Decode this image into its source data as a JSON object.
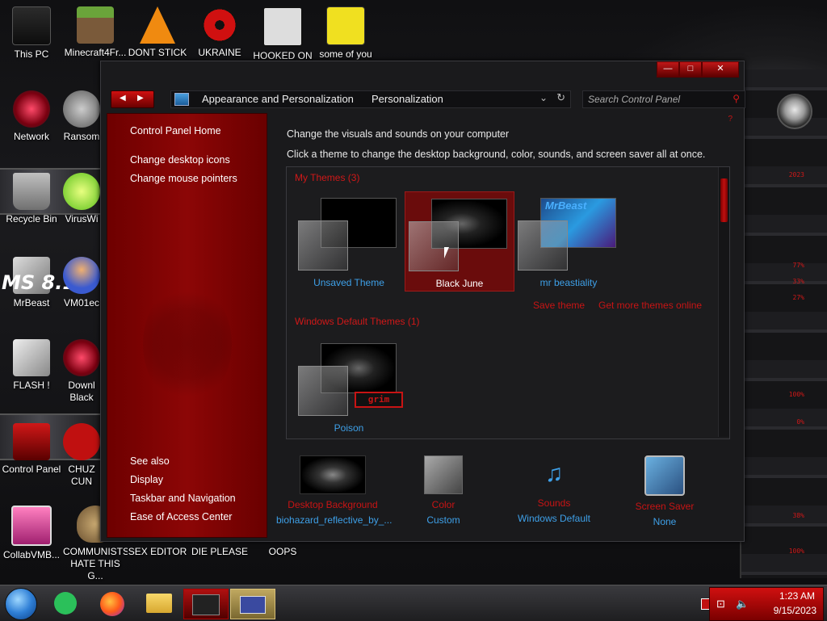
{
  "desktop": {
    "icons": [
      {
        "label": "This PC",
        "name": "this-pc-icon"
      },
      {
        "label": "Minecraft4Fr...",
        "name": "minecraft-icon"
      },
      {
        "label": "DONT STICK",
        "name": "vlc-cone-icon"
      },
      {
        "label": "UKRAINE",
        "name": "radiation-icon"
      },
      {
        "label": "HOOKED ON",
        "name": "maze-icon"
      },
      {
        "label": "some of you",
        "name": "cartoon-dog-icon"
      },
      {
        "label": "Network",
        "name": "network-icon"
      },
      {
        "label": "Ransom",
        "name": "ransom-icon"
      },
      {
        "label": "Recycle Bin",
        "name": "recycle-bin-icon"
      },
      {
        "label": "VirusWi",
        "name": "virus-icon"
      },
      {
        "label": "MrBeast",
        "name": "mrbeast-icon"
      },
      {
        "label": "VM01ec",
        "name": "vm-icon"
      },
      {
        "label": "FLASH !",
        "name": "flash-icon"
      },
      {
        "label": "Downl Black",
        "name": "download-icon"
      },
      {
        "label": "Control Panel",
        "name": "control-panel-icon"
      },
      {
        "label": "CHUZ CUN",
        "name": "chuz-icon"
      },
      {
        "label": "CollabVMB...",
        "name": "collabvm-icon"
      },
      {
        "label": "COMMUNISTS HATE THIS G...",
        "name": "money-bag-icon"
      },
      {
        "label": "SEX EDITOR",
        "name": "sex-editor-icon"
      },
      {
        "label": "DIE PLEASE",
        "name": "die-please-icon"
      },
      {
        "label": "OOPS",
        "name": "oops-icon"
      }
    ],
    "overlay_text": "MS 8.1"
  },
  "hud": {
    "lines": [
      "77%",
      "33%",
      "27%",
      "100%",
      "0%",
      "38%",
      "100%"
    ],
    "top_text": "2023"
  },
  "window": {
    "title_buttons": {
      "minimize": "—",
      "maximize": "□",
      "close": "✕"
    },
    "breadcrumb": [
      "Appearance and Personalization",
      "Personalization"
    ],
    "search_placeholder": "Search Control Panel",
    "sidebar": {
      "home": "Control Panel Home",
      "links": [
        "Change desktop icons",
        "Change mouse pointers"
      ],
      "see_also_title": "See also",
      "see_also": [
        "Display",
        "Taskbar and Navigation",
        "Ease of Access Center"
      ]
    },
    "intro1": "Change the visuals and sounds on your computer",
    "intro2": "Click a theme to change the desktop background, color, sounds, and screen saver all at once.",
    "my_themes_title": "My Themes (3)",
    "my_themes": [
      {
        "name": "Unsaved Theme",
        "selected": false
      },
      {
        "name": "Black June",
        "selected": true
      },
      {
        "name": "mr beastiality",
        "selected": false
      }
    ],
    "save_theme": "Save theme",
    "get_more": "Get more themes online",
    "default_themes_title": "Windows Default Themes (1)",
    "default_themes": [
      {
        "name": "Poison"
      }
    ],
    "poison_tag": "grim",
    "mrbeast_text": "MrBeast",
    "bottom": [
      {
        "title": "Desktop Background",
        "value": "biohazard_reflective_by_...",
        "name": "desktop-background"
      },
      {
        "title": "Color",
        "value": "Custom",
        "name": "color"
      },
      {
        "title": "Sounds",
        "value": "Windows Default",
        "name": "sounds"
      },
      {
        "title": "Screen Saver",
        "value": "None",
        "name": "screen-saver"
      }
    ]
  },
  "taskbar": {
    "time": "1:23 AM",
    "date": "9/15/2023"
  }
}
